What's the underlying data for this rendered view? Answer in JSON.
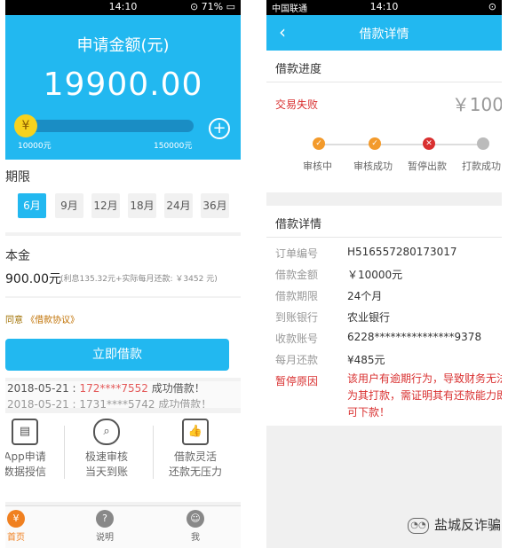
{
  "left_phone": {
    "status": {
      "time": "14:10",
      "battery": "71%"
    },
    "amount": {
      "title": "申请金额(元)",
      "value": "19900.00",
      "min": "10000元",
      "max": "150000元",
      "knob_symbol": "¥",
      "slider_level": 0.0
    },
    "term": {
      "label": "期限",
      "options": [
        "6月",
        "9月",
        "12月",
        "18月",
        "24月",
        "36月"
      ],
      "selected": "6月"
    },
    "principal": {
      "label": "本金",
      "value": "900.00元",
      "note": "(利息135.32元+实际每月还款: ￥3452 元)"
    },
    "agreement": {
      "prefix": "同意",
      "link": "《借款协议》"
    },
    "submit_label": "立即借款",
    "ticker": {
      "line1_date": "2018-05-21 :",
      "line1_phone": "172****7552",
      "line1_text": "成功借款！",
      "line2": "2018-05-21 : 1731****5742 成功借款！"
    },
    "features": [
      {
        "icon": "document-icon",
        "glyph": "▤",
        "line1": "App申请",
        "line2": "数据授信"
      },
      {
        "icon": "magnifier-icon",
        "glyph": "⌕",
        "line1": "极速审核",
        "line2": "当天到账"
      },
      {
        "icon": "thumbs-up-icon",
        "glyph": "👍",
        "line1": "借款灵活",
        "line2": "还款无压力"
      }
    ],
    "tabs": [
      {
        "label": "首页",
        "glyph": "¥",
        "active": true
      },
      {
        "label": "说明",
        "glyph": "?",
        "active": false
      },
      {
        "label": "我",
        "glyph": "☺",
        "active": false
      }
    ]
  },
  "right_phone": {
    "status": {
      "time": "14:10",
      "carrier": "中国联通"
    },
    "nav": {
      "back": "‹",
      "title": "借款详情"
    },
    "progress": {
      "heading": "借款进度",
      "status": "交易失败",
      "amount": "￥100",
      "steps": [
        {
          "label": "审核中",
          "state": "done",
          "color": "#f39a2b"
        },
        {
          "label": "审核成功",
          "state": "done",
          "color": "#f39a2b"
        },
        {
          "label": "暂停出款",
          "state": "fail",
          "color": "#d93030"
        },
        {
          "label": "打款成功",
          "state": "pending",
          "color": "#bbbbbb"
        }
      ]
    },
    "details": {
      "heading": "借款详情",
      "rows": [
        {
          "key": "订单编号",
          "value": "H516557280173017"
        },
        {
          "key": "借款金额",
          "value": "￥10000元"
        },
        {
          "key": "借款期限",
          "value": "24个月"
        },
        {
          "key": "到账银行",
          "value": "农业银行"
        },
        {
          "key": "收款账号",
          "value": "6228***************9378"
        },
        {
          "key": "每月还款",
          "value": "¥485元"
        }
      ],
      "pause_key": "暂停原因",
      "pause_reason": "该用户有逾期行为，导致财务无法为其打款，需证明其有还款能力即可下款！"
    }
  },
  "watermark": "盐城反诈骗"
}
